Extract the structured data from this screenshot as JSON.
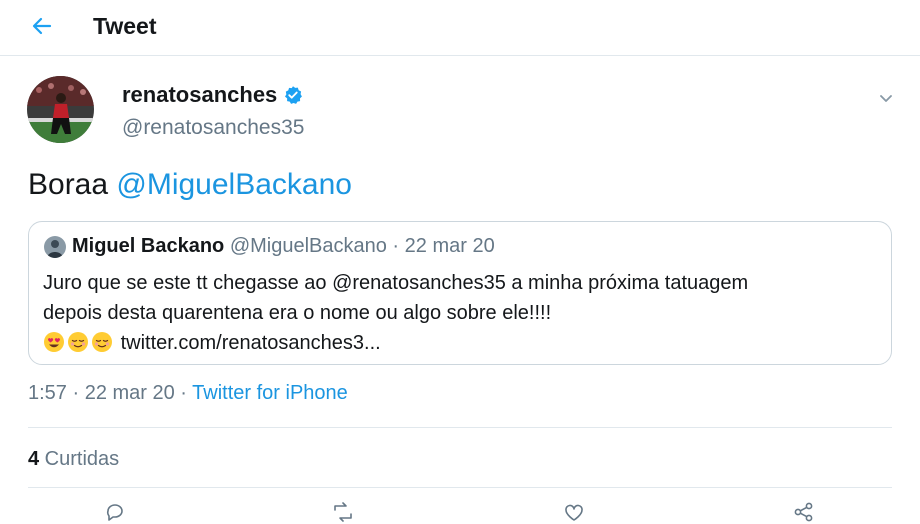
{
  "header": {
    "title": "Tweet"
  },
  "tweet": {
    "display_name": "renatosanches",
    "handle": "@renatosanches35",
    "verified": true,
    "text_prefix": "Boraa ",
    "text_mention": "@MiguelBackano",
    "timestamp": "1:57 · 22 mar 20 · ",
    "source": "Twitter for iPhone",
    "likes_count": "4",
    "likes_label": " Curtidas"
  },
  "quoted": {
    "display_name": "Miguel Backano",
    "meta": " @MiguelBackano · 22 mar 20",
    "line1": "Juro que se este tt chegasse ao @renatosanches35 a minha próxima tatuagem",
    "line2": "depois desta quarentena era o nome ou algo sobre ele!!!!",
    "link": "twitter.com/renatosanches3..."
  },
  "colors": {
    "accent": "#1b95e0",
    "text": "#14171a",
    "muted": "#657786",
    "border": "#e1e8ed"
  },
  "icons": {
    "back": "arrow-left-icon",
    "verified": "verified-badge-icon",
    "caret": "chevron-down-icon",
    "actions": [
      "reply-icon",
      "retweet-icon",
      "like-icon",
      "share-icon"
    ]
  }
}
